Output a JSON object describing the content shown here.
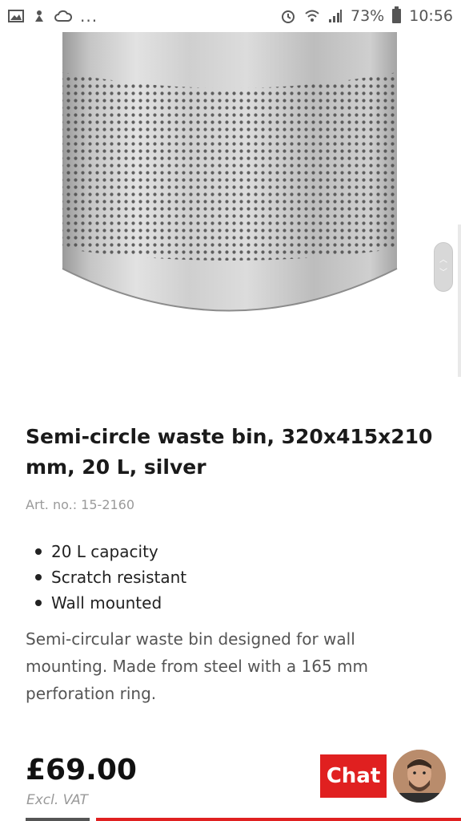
{
  "status_bar": {
    "battery": "73%",
    "time": "10:56",
    "overflow": "..."
  },
  "product": {
    "title": "Semi-circle waste bin, 320x415x210 mm, 20 L, silver",
    "art_no": "Art. no.: 15-2160",
    "features": [
      "20 L capacity",
      "Scratch resistant",
      "Wall mounted"
    ],
    "description": "Semi-circular waste bin designed for wall mounting. Made from steel with a 165 mm perforation ring.",
    "price": "£69.00",
    "vat_note": "Excl. VAT"
  },
  "chat": {
    "label": "Chat"
  },
  "colors": {
    "accent": "#e02020",
    "text": "#222222",
    "muted": "#9a9a9a"
  },
  "icons": [
    "image-icon",
    "notification-icon",
    "cloud-icon",
    "alarm-icon",
    "wifi-icon",
    "signal-icon",
    "battery-icon",
    "chevron-up-icon",
    "chevron-down-icon"
  ]
}
